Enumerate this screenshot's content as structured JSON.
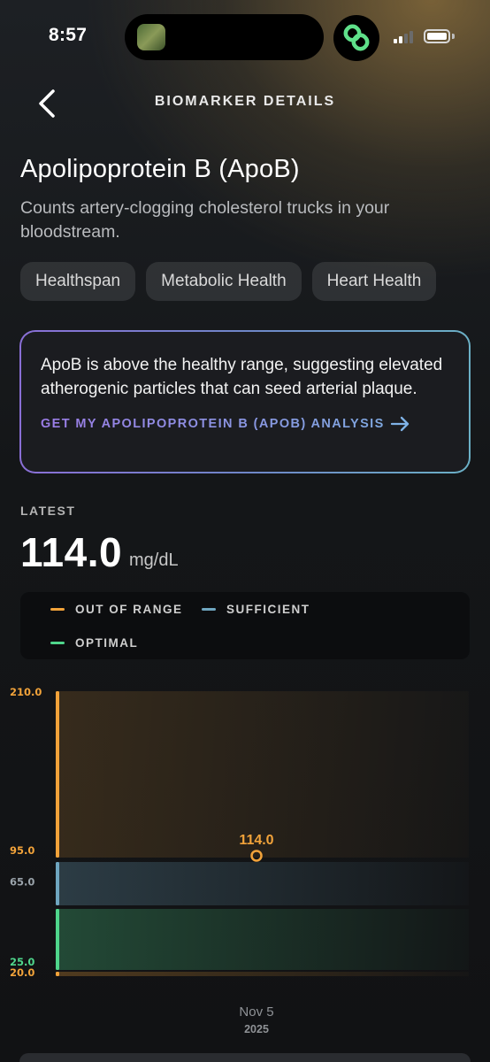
{
  "status_bar": {
    "time": "8:57"
  },
  "header": {
    "title": "BIOMARKER DETAILS"
  },
  "biomarker": {
    "name": "Apolipoprotein B (ApoB)",
    "description": "Counts artery-clogging cholesterol trucks in your bloodstream.",
    "tags": [
      "Healthspan",
      "Metabolic Health",
      "Heart Health"
    ]
  },
  "insight": {
    "text": "ApoB is above the healthy range, suggesting elevated atherogenic particles that can seed arterial plaque.",
    "cta": "GET MY APOLIPOPROTEIN B (APOB) ANALYSIS"
  },
  "latest": {
    "label": "LATEST",
    "value": "114.0",
    "unit": "mg/dL"
  },
  "legend": [
    {
      "label": "OUT OF RANGE",
      "color": "#f2a33a"
    },
    {
      "label": "SUFFICIENT",
      "color": "#6fa6c0"
    },
    {
      "label": "OPTIMAL",
      "color": "#4fd68c"
    }
  ],
  "colors": {
    "out_of_range": "#f2a33a",
    "sufficient": "#6fa6c0",
    "optimal": "#4fd68c"
  },
  "chart_data": {
    "type": "scatter",
    "y_ticks": [
      {
        "label": "210.0",
        "zone": "out_of_range"
      },
      {
        "label": "95.0",
        "zone": "out_of_range"
      },
      {
        "label": "65.0",
        "zone": "sufficient"
      },
      {
        "label": "25.0",
        "zone": "optimal"
      },
      {
        "label": "20.0",
        "zone": "out_of_range"
      }
    ],
    "bands": [
      {
        "zone": "out_of_range",
        "from": 95,
        "to": 210
      },
      {
        "zone": "sufficient",
        "from": 65,
        "to": 95
      },
      {
        "zone": "optimal",
        "from": 25,
        "to": 65
      },
      {
        "zone": "out_of_range",
        "from": 20,
        "to": 25
      }
    ],
    "points": [
      {
        "x_label": "Nov 5",
        "x_sublabel": "2025",
        "value": 114.0,
        "label": "114.0",
        "zone": "out_of_range"
      }
    ]
  }
}
